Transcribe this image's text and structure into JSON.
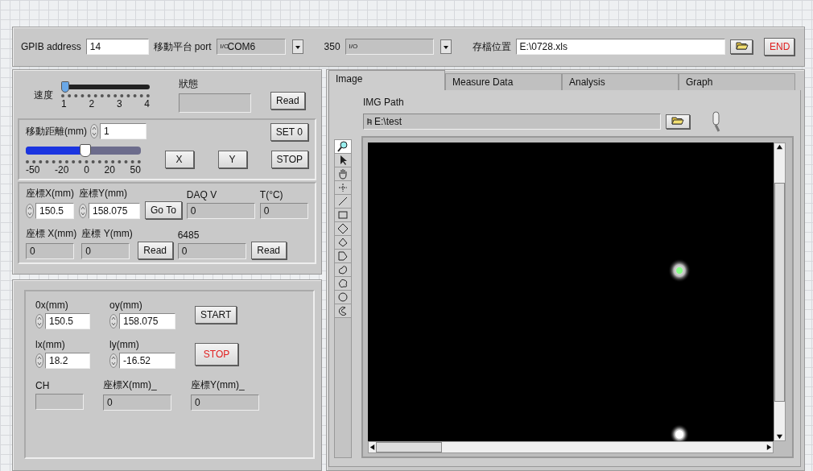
{
  "top_bar": {
    "gpib": {
      "label": "GPIB address",
      "value": "14"
    },
    "port": {
      "label": "移動平台 port",
      "prefix": "I/O",
      "value": "COM6"
    },
    "device": {
      "label": "350",
      "prefix": "I/O"
    },
    "save_path": {
      "label": "存檔位置",
      "value": "E:\\0728.xls"
    },
    "end_button": "END"
  },
  "motion": {
    "speed": {
      "label": "速度",
      "ticks": [
        "1",
        "2",
        "3",
        "4"
      ],
      "level": 0
    },
    "status": {
      "label": "狀態"
    },
    "status_read": "Read",
    "distance": {
      "label": "移動距離(mm)",
      "value": "1"
    },
    "distance_slider": {
      "ticks": [
        "-50",
        "-20",
        "0",
        "20",
        "50"
      ],
      "level": 0.51
    },
    "buttons": {
      "set0": "SET 0",
      "x": "X",
      "y": "Y",
      "stop": "STOP"
    }
  },
  "coords": {
    "row1": [
      {
        "kind": "numeric",
        "label": "座標X(mm)",
        "value": "150.5"
      },
      {
        "kind": "numeric",
        "label": "座標Y(mm)",
        "value": "158.075"
      },
      {
        "kind": "button",
        "label": "Go To"
      },
      {
        "kind": "indicator",
        "label": "DAQ V",
        "value": "0"
      },
      {
        "kind": "indicator",
        "label": "T(°C)",
        "value": "0"
      }
    ],
    "row2": [
      {
        "kind": "indicator",
        "label": "座標 X(mm)",
        "value": "0"
      },
      {
        "kind": "indicator",
        "label": "座標 Y(mm)",
        "value": "0"
      },
      {
        "kind": "button",
        "label": "Read"
      },
      {
        "kind": "indicator",
        "label": "6485",
        "value": "0"
      },
      {
        "kind": "button",
        "label": "Read"
      }
    ]
  },
  "scan": {
    "row1": [
      {
        "kind": "numeric",
        "label": "0x(mm)",
        "value": "150.5"
      },
      {
        "kind": "numeric",
        "label": "oy(mm)",
        "value": "158.075"
      },
      {
        "kind": "button",
        "label": "START",
        "alert": false
      }
    ],
    "row2": [
      {
        "kind": "numeric",
        "label": "lx(mm)",
        "value": "18.2"
      },
      {
        "kind": "numeric",
        "label": "ly(mm)",
        "value": "-16.52"
      },
      {
        "kind": "button",
        "label": "STOP",
        "alert": true
      }
    ],
    "row3": [
      {
        "kind": "indicator",
        "label": "CH"
      },
      {
        "kind": "indicator",
        "label": "座標X(mm)_",
        "value": "0"
      },
      {
        "kind": "indicator",
        "label": "座標Y(mm)_",
        "value": "0"
      }
    ]
  },
  "tabs": [
    {
      "label": "Image",
      "selected": true
    },
    {
      "label": "Measure Data",
      "selected": false
    },
    {
      "label": "Analysis",
      "selected": false
    },
    {
      "label": "Graph",
      "selected": false
    }
  ],
  "image_tab": {
    "path": {
      "label": "IMG Path",
      "value": "E:\\test"
    },
    "tools": [
      {
        "kind": "zoom",
        "selected": true
      },
      {
        "kind": "pointer",
        "selected": false
      },
      {
        "kind": "pan",
        "selected": false
      },
      {
        "kind": "crosshair",
        "selected": false
      },
      {
        "kind": "line",
        "selected": false
      },
      {
        "kind": "rect",
        "selected": false
      },
      {
        "kind": "rotated-rect",
        "selected": false
      },
      {
        "kind": "polygon",
        "selected": false
      },
      {
        "kind": "freehand-polygon",
        "selected": false
      },
      {
        "kind": "freehand",
        "selected": false
      },
      {
        "kind": "cloud",
        "selected": false
      },
      {
        "kind": "oval",
        "selected": false
      },
      {
        "kind": "annulus",
        "selected": false
      }
    ]
  }
}
